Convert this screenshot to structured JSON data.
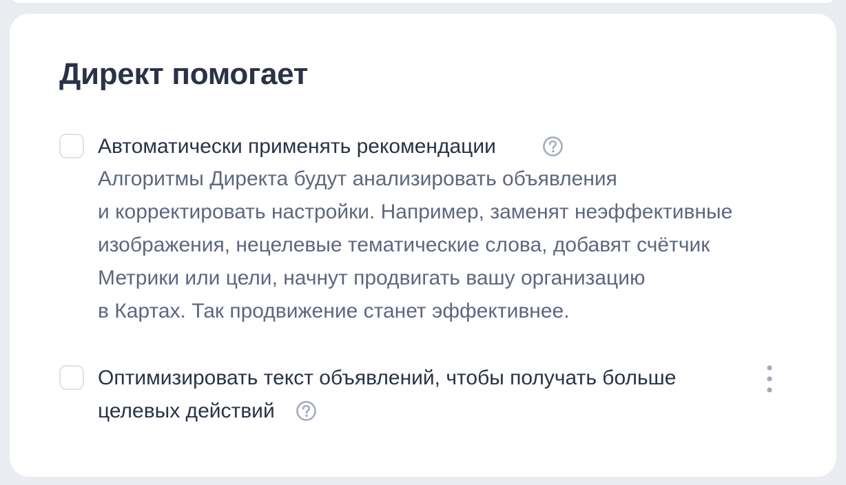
{
  "section": {
    "title": "Директ помогает"
  },
  "options": [
    {
      "label": "Автоматически применять рекомендации",
      "checked": false,
      "description_lines": [
        "Алгоритмы Директа будут анализировать объявления",
        "и корректировать настройки. Например, заменят неэффективные",
        "изображения, нецелевые тематические слова, добавят счётчик",
        "Метрики или цели, начнут продвигать вашу организацию",
        "в Картах. Так продвижение станет эффективнее."
      ]
    },
    {
      "label_lines": [
        "Оптимизировать текст объявлений, чтобы получать больше",
        "целевых действий"
      ],
      "checked": false
    }
  ],
  "icons": {
    "help": "question-circle-icon",
    "more": "vertical-dots-icon"
  },
  "colors": {
    "background": "#e9edf2",
    "card": "#ffffff",
    "title_text": "#2a3247",
    "description_text": "#5f6680",
    "icon": "#a3a9bb",
    "checkbox_border": "#dfe2e8"
  }
}
